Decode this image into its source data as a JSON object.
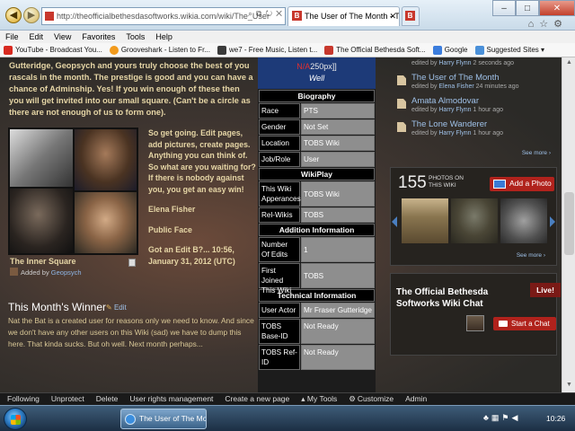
{
  "browser": {
    "url": "http://theofficialbethesdasoftworks.wikia.com/wiki/The_User",
    "active_tab": "The User of The Month - T...",
    "menu": [
      "File",
      "Edit",
      "View",
      "Favorites",
      "Tools",
      "Help"
    ],
    "favorites": [
      {
        "label": "YouTube - Broadcast You...",
        "color": "#d82a20"
      },
      {
        "label": "Grooveshark - Listen to Fr...",
        "color": "#f29b1d"
      },
      {
        "label": "we7 - Free Music, Listen t...",
        "color": "#3a3a3a"
      },
      {
        "label": "The Official Bethesda Soft...",
        "color": "#c8382d"
      },
      {
        "label": "Google",
        "color": "#3b7ddd"
      },
      {
        "label": "Suggested Sites ▾",
        "color": "#4a90d9"
      }
    ]
  },
  "main": {
    "intro": "Gutteridge, Geopsych and yours truly choose the best of you rascals in the month. The prestige is good and you can have a chance of Adminship. Yes! If you win enough of these then you will get invited into our small square. (Can't be a circle as there are not enough of us to form one).",
    "photo_caption": "The Inner Square",
    "added_by_prefix": "Added by",
    "added_by_user": "Geopsych",
    "promo": [
      "So get going. Edit pages, add pictures, create pages. Anything you can think of. So what are you waiting for? If there is nobody against you, you get an easy win!",
      "Elena Fisher",
      "Public Face",
      "Got an Edit B?... 10:56, January 31, 2012 (UTC)"
    ],
    "winner_title": "This Month's Winner",
    "winner_edit": "Edit",
    "winner_text": "Nat the Bat is a created user for reasons only we need to know. And since we don't have any other users on this Wiki (sad) we have to dump this here. That kinda sucks. But oh well. Next month perhaps..."
  },
  "infobox": {
    "top_broken": "N/A",
    "top_rest": "250px]]",
    "top_name": "Well",
    "sections": [
      {
        "title": "Biography",
        "rows": [
          {
            "k": "Race",
            "v": "PTS"
          },
          {
            "k": "Gender",
            "v": "Not Set"
          },
          {
            "k": "Location",
            "v": "TOBS Wiki"
          },
          {
            "k": "Job/Role",
            "v": "User"
          }
        ]
      },
      {
        "title": "WikiPlay",
        "rows": [
          {
            "k": "This Wiki Apperances",
            "v": "TOBS Wiki"
          },
          {
            "k": "Rel-Wikis",
            "v": "TOBS"
          }
        ]
      },
      {
        "title": "Addition Information",
        "rows": [
          {
            "k": "Number Of Edits",
            "v": "1"
          },
          {
            "k": "First Joined This Wiki",
            "v": "TOBS"
          }
        ]
      },
      {
        "title": "Technical Information",
        "rows": [
          {
            "k": "User Actor",
            "v": "Mr Fraser Gutteridge"
          },
          {
            "k": "TOBS Base-ID",
            "v": "Not Ready"
          },
          {
            "k": "TOBS Ref-ID",
            "v": "Not Ready"
          }
        ]
      }
    ]
  },
  "rail": {
    "activity": [
      {
        "title": "",
        "meta_prefix": "edited by",
        "user": "Harry Flynn",
        "time": "2 seconds ago"
      },
      {
        "title": "The User of The Month",
        "meta_prefix": "edited by",
        "user": "Elena Fisher",
        "time": "24 minutes ago"
      },
      {
        "title": "Amata Almodovar",
        "meta_prefix": "edited by",
        "user": "Harry Flynn",
        "time": "1 hour ago"
      },
      {
        "title": "The Lone Wanderer",
        "meta_prefix": "edited by",
        "user": "Harry Flynn",
        "time": "1 hour ago"
      }
    ],
    "see_more": "See more ›",
    "photos_count": "155",
    "photos_label_1": "PHOTOS ON",
    "photos_label_2": "THIS WIKI",
    "add_photo": "Add a Photo",
    "chat_title": "The Official Bethesda Softworks Wiki Chat",
    "live": "Live!",
    "start_chat": "Start a Chat"
  },
  "toolbar": {
    "items": [
      "Following",
      "Unprotect",
      "Delete",
      "User rights management",
      "Create a new page",
      "My Tools",
      "Customize",
      "Admin"
    ]
  },
  "taskbar": {
    "app": "The User of The Mo...",
    "time": "10:26"
  }
}
